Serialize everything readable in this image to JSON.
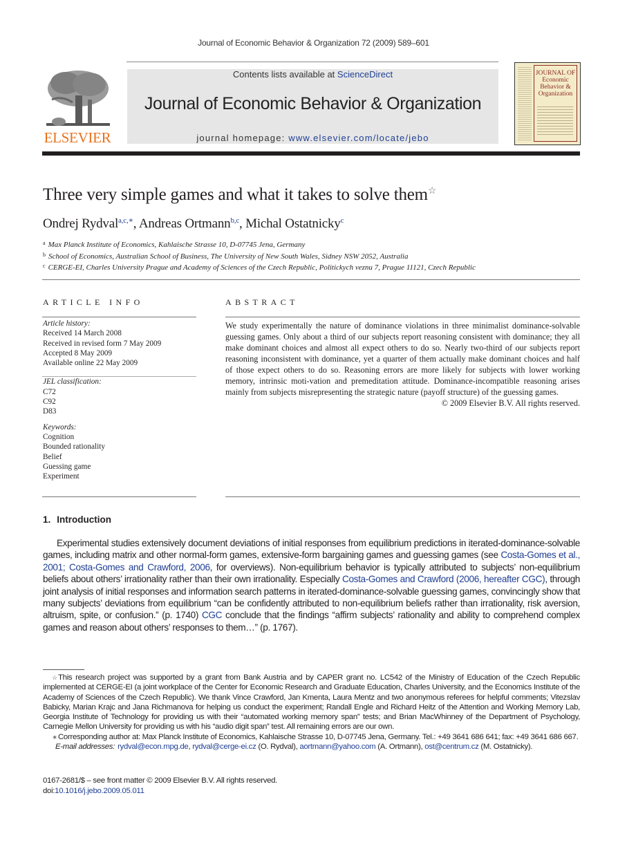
{
  "running_head": "Journal of Economic Behavior & Organization 72 (2009) 589–601",
  "masthead": {
    "publisher_logo": "ELSEVIER",
    "contents_prefix": "Contents lists available at ",
    "contents_link": "ScienceDirect",
    "journal_title": "Journal of Economic Behavior & Organization",
    "homepage_prefix": "journal homepage: ",
    "homepage_link": "www.elsevier.com/locate/jebo",
    "cover_title": [
      "JOURNAL OF",
      "Economic",
      "Behavior &",
      "Organization"
    ],
    "colors": {
      "elsevier_orange": "#e9711c",
      "link_blue": "#1f3f93",
      "banner_gray": "#e6e6e6",
      "cover_red": "#8c2a22"
    }
  },
  "article": {
    "title": "Three very simple games and what it takes to solve them",
    "title_mark": "☆",
    "authors": [
      {
        "name": "Ondrej Rydval",
        "sup": "a,c,∗"
      },
      {
        "name": "Andreas Ortmann",
        "sup": "b,c"
      },
      {
        "name": "Michal Ostatnicky",
        "sup": "c"
      }
    ],
    "affiliations": [
      {
        "mark": "a",
        "text": "Max Planck Institute of Economics, Kahlaische Strasse 10, D-07745 Jena, Germany"
      },
      {
        "mark": "b",
        "text": "School of Economics, Australian School of Business, The University of New South Wales, Sidney NSW 2052, Australia"
      },
      {
        "mark": "c",
        "text": "CERGE-EI, Charles University Prague and Academy of Sciences of the Czech Republic, Politickych veznu 7, Prague 11121, Czech Republic"
      }
    ]
  },
  "article_info": {
    "heading": "ARTICLE INFO",
    "history_label": "Article history:",
    "history": [
      "Received 14 March 2008",
      "Received in revised form 7 May 2009",
      "Accepted 8 May 2009",
      "Available online 22 May 2009"
    ],
    "jel_label": "JEL classification:",
    "jel": [
      "C72",
      "C92",
      "D83"
    ],
    "keywords_label": "Keywords:",
    "keywords": [
      "Cognition",
      "Bounded rationality",
      "Belief",
      "Guessing game",
      "Experiment"
    ]
  },
  "abstract": {
    "heading": "ABSTRACT",
    "text": "We study experimentally the nature of dominance violations in three minimalist dominance-solvable guessing games. Only about a third of our subjects report reasoning consistent with dominance; they all make dominant choices and almost all expect others to do so. Nearly two-third of our subjects report reasoning inconsistent with dominance, yet a quarter of them actually make dominant choices and half of those expect others to do so. Reasoning errors are more likely for subjects with lower working memory, intrinsic moti-vation and premeditation attitude. Dominance-incompatible reasoning arises mainly from subjects misrepresenting the strategic nature (payoff structure) of the guessing games.",
    "copyright": "© 2009 Elsevier B.V. All rights reserved."
  },
  "introduction": {
    "number": "1.",
    "heading": "Introduction",
    "p1": "Experimental studies extensively document deviations of initial responses from equilibrium predictions in iterated-dominance-solvable games, including matrix and other normal-form games, extensive-form bargaining games and guessing games (see ",
    "ref1": "Costa-Gomes et al., 2001; Costa-Gomes and Crawford, 2006",
    "p2": ", for overviews). Non-equilibrium behavior is typically attributed to subjects’ non-equilibrium beliefs about others’ irrationality rather than their own irrationality. Especially ",
    "ref2": "Costa-Gomes and Crawford (2006, hereafter CGC)",
    "p3": ", through joint analysis of initial responses and information search patterns in iterated-dominance-solvable guessing games, convincingly show that many subjects’ deviations from equilibrium “can be confidently attributed to non-equilibrium beliefs rather than irrationality, risk aversion, altruism, spite, or confusion.” (p. 1740) ",
    "ref3": "CGC",
    "p4": " conclude that the findings “affirm subjects’ rationality and ability to comprehend complex games and reason about others’ responses to them…” (p. 1767)."
  },
  "footnotes": {
    "star_mark": "☆",
    "star_text": "This research project was supported by a grant from Bank Austria and by CAPER grant no. LC542 of the Ministry of Education of the Czech Republic implemented at CERGE-EI (a joint workplace of the Center for Economic Research and Graduate Education, Charles University, and the Economics Institute of the Academy of Sciences of the Czech Republic). We thank Vince Crawford, Jan Kmenta, Laura Mentz and two anonymous referees for helpful comments; Vitezslav Babicky, Marian Krajc and Jana Richmanova for helping us conduct the experiment; Randall Engle and Richard Heitz of the Attention and Working Memory Lab, Georgia Institute of Technology for providing us with their “automated working memory span” tests; and Brian MacWhinney of the Department of Psychology, Carnegie Mellon University for providing us with his “audio digit span” test. All remaining errors are our own.",
    "corr_mark": "∗",
    "corr_text": "Corresponding author at: Max Planck Institute of Economics, Kahlaische Strasse 10, D-07745 Jena, Germany. Tel.: +49 3641 686 641; fax: +49 3641 686 667.",
    "email_label": "E-mail addresses:",
    "emails": [
      {
        "address": "rydval@econ.mpg.de",
        "after": ", "
      },
      {
        "address": "rydval@cerge-ei.cz",
        "after": " (O. Rydval), "
      },
      {
        "address": "aortmann@yahoo.com",
        "after": " (A. Ortmann), "
      },
      {
        "address": "ost@centrum.cz",
        "after": " (M. Ostatnicky)."
      }
    ]
  },
  "front_matter": {
    "issn_line": "0167-2681/$ – see front matter © 2009 Elsevier B.V. All rights reserved.",
    "doi_prefix": "doi:",
    "doi": "10.1016/j.jebo.2009.05.011"
  }
}
